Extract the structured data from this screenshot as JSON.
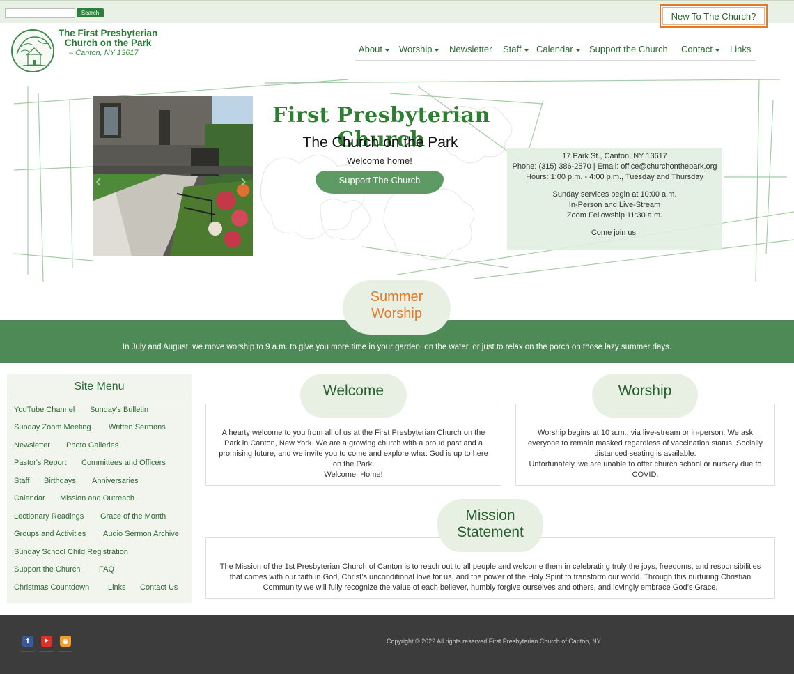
{
  "topbar": {
    "search_placeholder": "",
    "search_button": "Search",
    "new_to_church": "New To The Church?"
  },
  "logo": {
    "title_line1": "The First Presbyterian",
    "title_line2": "Church on the Park",
    "location": "– Canton, NY 13617"
  },
  "nav": {
    "items": [
      {
        "label": "About",
        "dropdown": true
      },
      {
        "label": "Worship",
        "dropdown": true
      },
      {
        "label": "Newsletter",
        "dropdown": false
      },
      {
        "label": "Staff",
        "dropdown": true
      },
      {
        "label": "Calendar",
        "dropdown": true
      },
      {
        "label": "Support the Church",
        "dropdown": false
      },
      {
        "label": "Contact",
        "dropdown": true
      },
      {
        "label": "Links",
        "dropdown": false
      }
    ]
  },
  "hero": {
    "title": "First Presbyterian Church",
    "subtitle": "The Church on the Park",
    "welcome": "Welcome home!",
    "support_button": "Support The Church",
    "prev_arrow": "‹",
    "next_arrow": "›",
    "info": {
      "address": "17 Park St., Canton, NY 13617",
      "contact": "Phone: (315) 386-2570 | Email: office@churchonthepark.org",
      "hours": "Hours: 1:00 p.m. - 4:00 p.m., Tuesday and Thursday",
      "services": "Sunday services begin at 10:00 a.m.",
      "format": "In-Person and Live-Stream",
      "fellowship": "Zoom Fellowship 11:30 a.m.",
      "join": "Come join us!"
    }
  },
  "summer": {
    "title_line1": "Summer",
    "title_line2": "Worship",
    "text": "In July and August, we move worship to 9 a.m. to give you more time in your garden, on the water, or just to relax on the porch on those lazy summer days."
  },
  "sidebar": {
    "title": "Site Menu",
    "links": [
      "YouTube Channel",
      "Sunday's Bulletin",
      "Sunday Zoom Meeting",
      "Written Sermons",
      "Newsletter",
      "Photo Galleries",
      "Pastor's Report",
      "Committees and Officers",
      "Staff",
      "Birthdays",
      "Anniversaries",
      "Calendar",
      "Mission and Outreach",
      "Lectionary Readings",
      "Grace of the Month",
      "Groups and Activities",
      "Audio Sermon Archive",
      "Sunday School Child Registration",
      "Support the Church",
      "FAQ",
      "Christmas Countdown",
      "Links",
      "Contact Us"
    ]
  },
  "welcome": {
    "title": "Welcome",
    "text": "A hearty welcome to you from all of us at the First Presbyterian Church on the Park in Canton, New York. We are a growing church with a proud past and a promising future, and we invite you to come and explore what God is up to here on the Park.",
    "closing": "Welcome, Home!"
  },
  "worship": {
    "title": "Worship",
    "text": "Worship begins at 10 a.m., via live-stream or in-person. We ask everyone to remain masked regardless of vaccination status. Socially distanced seating is available.",
    "note": "Unfortunately, we are unable to offer church school or nursery due to COVID."
  },
  "mission": {
    "title_line1": "Mission",
    "title_line2": "Statement",
    "text": "The Mission of the 1st Presbyterian Church of Canton is to reach out to all people and welcome them in celebrating truly the joys, freedoms, and responsibilities that comes with our faith in God, Christ’s unconditional love for us, and the power of the Holy Spirit to transform our world. Through this nurturing Christian Community we will fully recognize the value of each believer, humbly forgive ourselves and others, and lovingly embrace God’s Grace."
  },
  "footer": {
    "social": [
      {
        "icon": "facebook-icon",
        "glyph": "f",
        "color": "#3b5998"
      },
      {
        "icon": "youtube-icon",
        "glyph": "▶",
        "color": "#d9322b"
      },
      {
        "icon": "rss-icon",
        "glyph": "◉",
        "color": "#f0a030"
      }
    ],
    "copyright": "Copyright © 2022 All rights reserved First Presbyterian Church of Canton, NY"
  },
  "colors": {
    "brand_green": "#2e7d3a",
    "band_green": "#4e8a55",
    "accent_orange": "#e07b2c",
    "footer_bg": "#3c3c3c"
  }
}
